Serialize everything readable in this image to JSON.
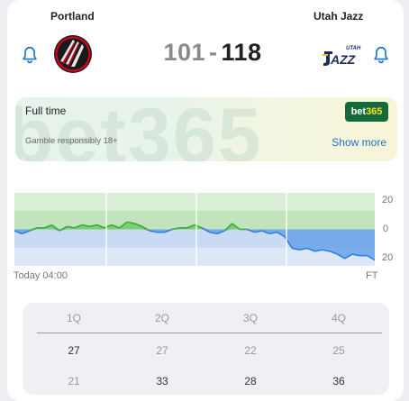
{
  "match": {
    "home_team": "Portland",
    "away_team": "Utah Jazz",
    "home_score": "101",
    "separator": "-",
    "away_score": "118",
    "home_logo_icon": "trail-blazers-logo-icon",
    "away_logo_icon": "utah-jazz-logo-icon",
    "bell_icon": "bell-icon"
  },
  "banner": {
    "status": "Full time",
    "gamble_notice": "Gamble responsibly 18+",
    "sponsor_logo": "bet365",
    "show_more": "Show more",
    "watermark": "bet365"
  },
  "momentum": {
    "axis_labels": [
      "20",
      "0",
      "20"
    ],
    "start_time": "Today 04:00",
    "end_time": "FT",
    "colors": {
      "home": "#3aa83d",
      "away": "#2f7fe0"
    },
    "points": [
      -1,
      -3,
      -1,
      1,
      1,
      3,
      -1,
      2,
      1,
      3,
      2,
      3,
      1,
      3,
      1,
      5,
      4,
      2,
      -1,
      -2,
      -2,
      0,
      1,
      1,
      3,
      1,
      -2,
      -3,
      -1,
      4,
      0,
      0,
      -2,
      -1,
      -3,
      -2,
      -5,
      -13,
      -14,
      -13,
      -15,
      -14,
      -15,
      -17,
      -20,
      -17,
      -18,
      -18,
      -21
    ]
  },
  "quarters": {
    "headers": [
      "1Q",
      "2Q",
      "3Q",
      "4Q"
    ],
    "home": [
      "27",
      "27",
      "22",
      "25"
    ],
    "away": [
      "21",
      "33",
      "28",
      "36"
    ]
  }
}
